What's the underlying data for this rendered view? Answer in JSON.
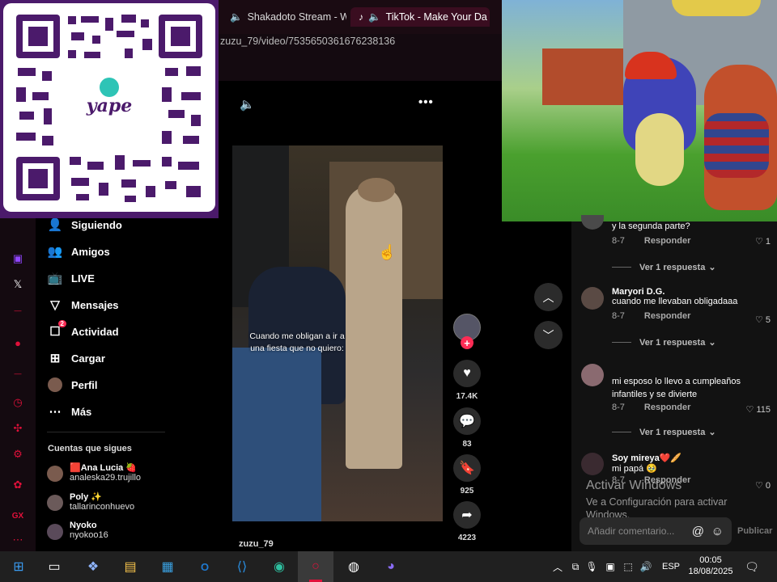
{
  "browser": {
    "tabs": [
      {
        "label": "Shakadoto Stream - W",
        "icon": "stream-icon",
        "speaker": true
      },
      {
        "label": "TikTok - Make Your Da",
        "icon": "tiktok-icon",
        "speaker": true
      }
    ],
    "url": "zuzu_79/video/7535650361676238136"
  },
  "overlay": {
    "qr_brand": "yape"
  },
  "tiktok_nav": [
    {
      "label": "Siguiendo",
      "icon": "following-icon"
    },
    {
      "label": "Amigos",
      "icon": "friends-icon"
    },
    {
      "label": "LIVE",
      "icon": "live-icon"
    },
    {
      "label": "Mensajes",
      "icon": "messages-icon"
    },
    {
      "label": "Actividad",
      "icon": "activity-icon",
      "badge": "2"
    },
    {
      "label": "Cargar",
      "icon": "upload-icon"
    },
    {
      "label": "Perfil",
      "icon": "profile-icon"
    },
    {
      "label": "Más",
      "icon": "more-icon"
    }
  ],
  "following": {
    "heading": "Cuentas que sigues",
    "accounts": [
      {
        "name": "🟥Ana Lucia 🍓",
        "handle": "analeska29.trujillo"
      },
      {
        "name": "Poly ✨",
        "handle": "tallarinconhuevo"
      },
      {
        "name": "Nyoko",
        "handle": "nyokoo16"
      }
    ]
  },
  "video": {
    "caption_line1": "Cuando me obligan a ir a",
    "caption_line2": "una fiesta que no quiero:",
    "author": "zuzu_79",
    "likes": "17.4K",
    "comments": "83",
    "saves": "925",
    "shares": "4223"
  },
  "comments": [
    {
      "user": "",
      "text": "y la segunda parte?",
      "date": "8-7",
      "reply": "Responder",
      "likes": "1",
      "more": "Ver 1 respuesta"
    },
    {
      "user": "Maryori D.G.",
      "text": "cuando me llevaban obligadaaa",
      "date": "8-7",
      "reply": "Responder",
      "likes": "5",
      "more": "Ver 1 respuesta"
    },
    {
      "user": "",
      "text": "mi esposo lo llevo a cumpleaños infantiles y se divierte",
      "date": "8-7",
      "reply": "Responder",
      "likes": "115",
      "more": "Ver 1 respuesta"
    },
    {
      "user": "Soy mireya❤️🥖",
      "text": "mi papá 🥹",
      "date": "8-7",
      "reply": "Responder",
      "likes": "0",
      "more": ""
    }
  ],
  "comment_input": {
    "placeholder": "Añadir comentario...",
    "post": "Publicar"
  },
  "watermark": {
    "line1": "Activar Windows",
    "line2": "Ve a Configuración para activar",
    "line3": "Windows."
  },
  "taskbar": {
    "lang": "ESP",
    "time": "00:05",
    "date": "18/08/2025"
  },
  "colors": {
    "accent": "#fe2c55",
    "opera": "#e0103a",
    "qr": "#4b1a6b"
  }
}
